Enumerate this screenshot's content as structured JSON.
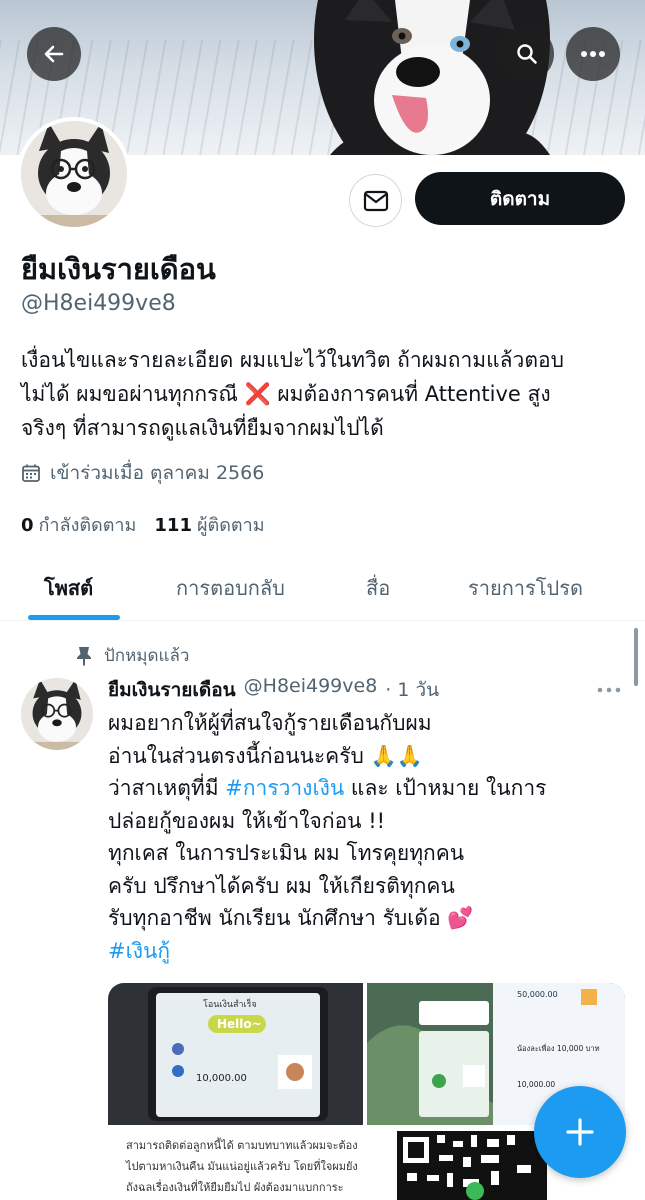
{
  "profile": {
    "name": "ยืมเงินรายเดือน",
    "handle": "@H8ei499ve8",
    "bio_lines": [
      "เงื่อนไขและรายละเอียด ผมแปะไว้ในทวิต ถ้าผมถามแล้วตอบ",
      "ไม่ได้ ผมขอผ่านทุกกรณี ❌ ผมต้องการคนที่ Attentive สูง",
      "จริงๆ ที่สามารถดูแลเงินที่ยืมจากผมไปได้"
    ],
    "joined": "เข้าร่วมเมื่อ ตุลาคม 2566",
    "following_count": "0",
    "following_label": "กำลังติดตาม",
    "followers_count": "111",
    "followers_label": "ผู้ติดตาม"
  },
  "actions": {
    "follow_label": "ติดตาม"
  },
  "tabs": [
    {
      "label": "โพสต์",
      "active": true
    },
    {
      "label": "การตอบกลับ",
      "active": false
    },
    {
      "label": "สื่อ",
      "active": false
    },
    {
      "label": "รายการโปรด",
      "active": false
    }
  ],
  "post": {
    "pinned_label": "ปักหมุดแล้ว",
    "author_name": "ยืมเงินรายเดือน",
    "author_handle": "@H8ei499ve8",
    "time": "· 1 วัน",
    "lines": {
      "l1": "ผมอยากให้ผู้ที่สนใจกู้รายเดือนกับผม",
      "l2": "อ่านในส่วนตรงนี้ก่อนนะครับ 🙏🙏",
      "l3_pre": "ว่าสาเหตุที่มี ",
      "l3_tag": "#การวางเงิน",
      "l3_post": " และ เป้าหมาย ในการ",
      "l4": "ปล่อยกู้ของผม ให้เข้าใจก่อน !!",
      "l5": "ทุกเคส ในการประเมิน ผม โทรคุยทุกคน",
      "l6": "ครับ ปรึกษาได้ครับ ผม ให้เกียรติทุกคน",
      "l7": "รับทุกอาชีพ นักเรียน นักศึกษา รับเด้อ 💕",
      "l8_tag": "#เงินกู้"
    },
    "media": {
      "img1": {
        "heading": "โอนเงินสำเร็จ",
        "sticker": "Hello~",
        "amount": "10,000.00",
        "footer": "สามารถติดต่อลูกหนี้ได้ ตามบทบาทแล้วผมจะต้อง",
        "footer2": "ไปตามหาเงินคืน มันแน่อยู่แล้วครับ โดยที่ใจผมยัง",
        "footer3": "ถังฉลเรื่องเงินที่ให้ยืมยืมไป ผังต้องมาแบกการะ"
      },
      "img2": {
        "amount_top": "50,000.00",
        "caption": "น้องละเพื่อง 10,000 บาท",
        "amount_mid": "10,000.00"
      }
    }
  },
  "colors": {
    "accent": "#1d9bf0",
    "text": "#0f1419",
    "muted": "#536471"
  },
  "icons": [
    "back-arrow-icon",
    "search-icon",
    "more-icon",
    "mail-icon",
    "calendar-icon",
    "pin-icon",
    "plus-icon"
  ]
}
